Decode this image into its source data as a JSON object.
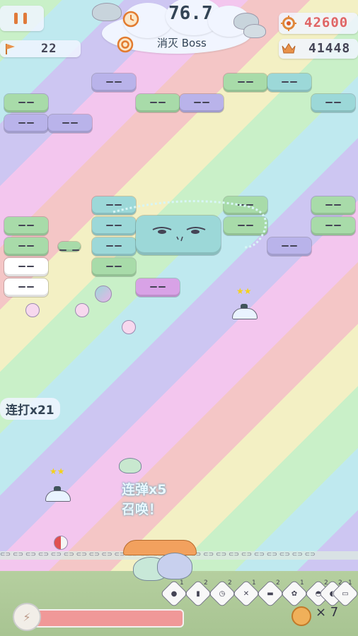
{
  "hud": {
    "timer": "76.7",
    "goal": "消灭 Boss",
    "score": "42600",
    "best": "41448",
    "level": "22",
    "icons": [
      "pause-icon",
      "flag-icon",
      "clock-icon",
      "target-icon",
      "crosshair-icon",
      "crown-icon"
    ]
  },
  "combo": "连打x21",
  "messages": {
    "line1": "连弹x5",
    "line2": "召唤！"
  },
  "bottom": {
    "slots": [
      {
        "icon": "ball-icon",
        "count": "1"
      },
      {
        "icon": "bottle-icon",
        "count": "2"
      },
      {
        "icon": "clock-icon",
        "count": "2"
      },
      {
        "icon": "bomb-icon",
        "count": "1"
      },
      {
        "icon": "brick-icon",
        "count": "2"
      },
      {
        "icon": "flower-icon",
        "count": "1"
      },
      {
        "icon": "pot-icon",
        "count": "2"
      },
      {
        "icon": "fish-icon",
        "count": "2"
      },
      {
        "icon": "paddle-icon",
        "count": "1"
      }
    ],
    "coins": "× 7"
  },
  "colors": {
    "brick_purple": "#b9b3ea",
    "brick_green": "#a8dba9",
    "brick_teal": "#9cd8d8",
    "brick_violet": "#d8a2e6",
    "energy": "#f09898",
    "coin": "#f0b05a"
  }
}
